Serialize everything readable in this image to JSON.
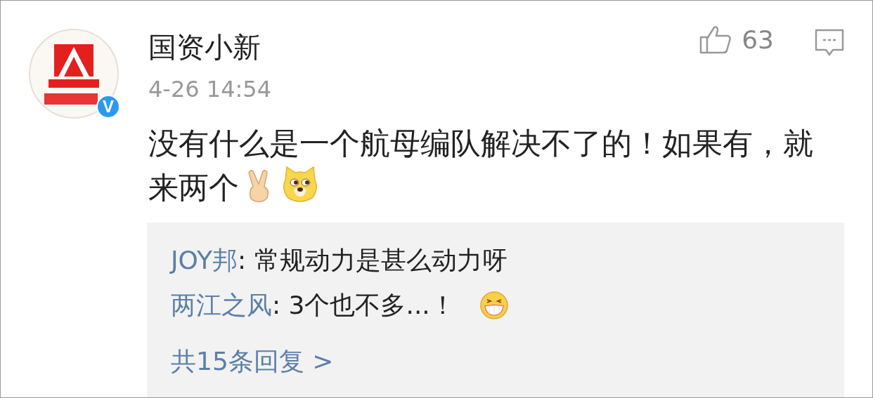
{
  "post": {
    "author": "国资小新",
    "verified": true,
    "verified_badge": "V",
    "time": "4-26 14:54",
    "likes": "63",
    "text_lines": [
      "没有什么是一个航母编队解决不了的！如果有，就",
      "来两个"
    ]
  },
  "replies": [
    {
      "author": "JOY邦",
      "text": ": 常规动力是甚么动力呀",
      "emoji": false
    },
    {
      "author": "两江之风",
      "text": ": 3个也不多...！",
      "emoji": true
    }
  ],
  "more_replies": "共15条回复 >"
}
